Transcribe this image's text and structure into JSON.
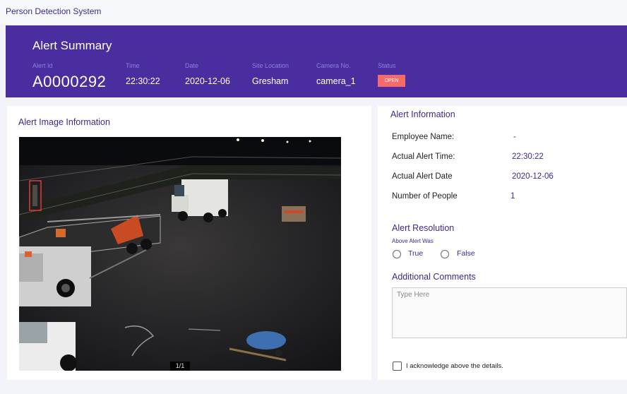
{
  "app": {
    "title": "Person Detection System"
  },
  "summary": {
    "title": "Alert Summary",
    "fields": {
      "alert_id": {
        "label": "Alert Id",
        "value": "A0000292"
      },
      "time": {
        "label": "Time",
        "value": "22:30:22"
      },
      "date": {
        "label": "Date",
        "value": "2020-12-06"
      },
      "site": {
        "label": "Site Location",
        "value": "Gresham"
      },
      "camera": {
        "label": "Camera No.",
        "value": "camera_1"
      },
      "status": {
        "label": "Status",
        "value": "OPEN"
      }
    },
    "colors": {
      "banner": "#4a2ea0",
      "label": "#8f7fe0",
      "status_open": "#f56b6b"
    }
  },
  "image_panel": {
    "title": "Alert Image Information",
    "counter": "1/1",
    "detection_box_color": "#e53935"
  },
  "alert_info": {
    "title": "Alert Information",
    "rows": [
      {
        "label": "Employee Name:",
        "value": "-"
      },
      {
        "label": "Actual Alert Time:",
        "value": "22:30:22"
      },
      {
        "label": "Actual Alert Date",
        "value": "2020-12-06"
      },
      {
        "label": "Number of People",
        "value": "1"
      }
    ]
  },
  "resolution": {
    "title": "Alert Resolution",
    "caption": "Above Alert Was",
    "options": [
      "True",
      "False"
    ]
  },
  "comments": {
    "title": "Additional Comments",
    "placeholder": "Type Here"
  },
  "acknowledge": {
    "label": "I acknowledge above the details."
  }
}
